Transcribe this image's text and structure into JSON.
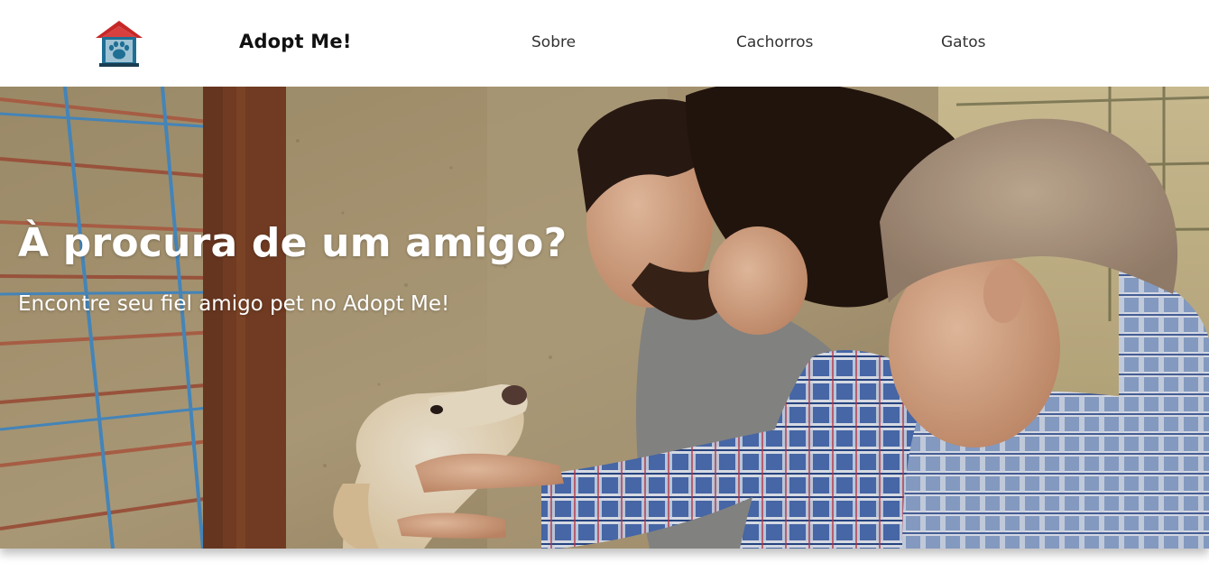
{
  "nav": {
    "logo_icon": "dog-house-paw-icon",
    "brand": "Adopt Me!",
    "links": [
      {
        "label": "Sobre"
      },
      {
        "label": "Cachorros"
      },
      {
        "label": "Gatos"
      }
    ]
  },
  "hero": {
    "title": "À procura de um amigo?",
    "subtitle": "Encontre seu fiel amigo pet no Adopt Me!",
    "image_subject": "family-petting-shelter-dog-photo"
  },
  "colors": {
    "logo_roof": "#c62828",
    "logo_body": "#1f6f95",
    "paw": "#1f6f95",
    "nav_text": "#333333",
    "brand_text": "#111111",
    "hero_text": "#ffffff"
  }
}
